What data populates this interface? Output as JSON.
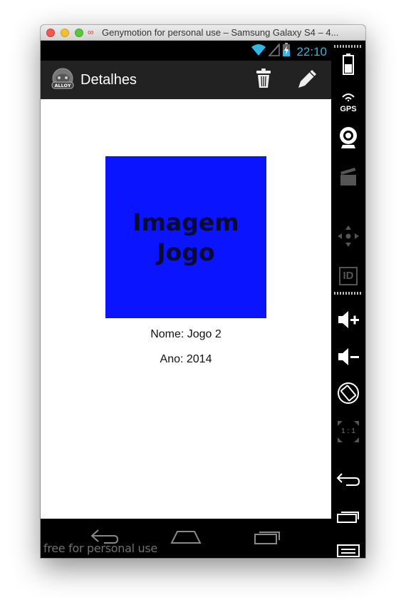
{
  "window": {
    "title": "Genymotion for personal use – Samsung Galaxy S4 – 4...",
    "app_icon": "∞"
  },
  "statusbar": {
    "time": "22:10",
    "icons": [
      "wifi-icon",
      "signal-icon",
      "battery-charging-icon"
    ],
    "accent_color": "#33b5e5"
  },
  "actionbar": {
    "title": "Detalhes",
    "logo_text": "ALLOY",
    "actions": [
      "delete",
      "edit"
    ]
  },
  "content": {
    "image_text_line1": "Imagem",
    "image_text_line2": "Jogo",
    "image_color": "#0a14ff",
    "name_line": "Nome: Jogo 2",
    "year_line": "Ano: 2014"
  },
  "navbar": {
    "buttons": [
      "back",
      "home",
      "recent-apps"
    ]
  },
  "watermark": "free for personal use",
  "sidepanel": {
    "items": [
      {
        "name": "battery-widget-button",
        "label": ""
      },
      {
        "name": "gps-widget-button",
        "label": "GPS"
      },
      {
        "name": "camera-widget-button",
        "label": ""
      },
      {
        "name": "capture-widget-button",
        "label": ""
      },
      {
        "name": "remote-control-widget-button",
        "label": ""
      },
      {
        "name": "device-id-widget-button",
        "label": "ID"
      },
      {
        "name": "volume-up-button",
        "label": ""
      },
      {
        "name": "volume-down-button",
        "label": ""
      },
      {
        "name": "rotate-button",
        "label": ""
      },
      {
        "name": "pixel-perfect-button",
        "label": "1 : 1"
      },
      {
        "name": "back-button",
        "label": ""
      },
      {
        "name": "recent-apps-button",
        "label": ""
      },
      {
        "name": "menu-button",
        "label": ""
      }
    ]
  }
}
